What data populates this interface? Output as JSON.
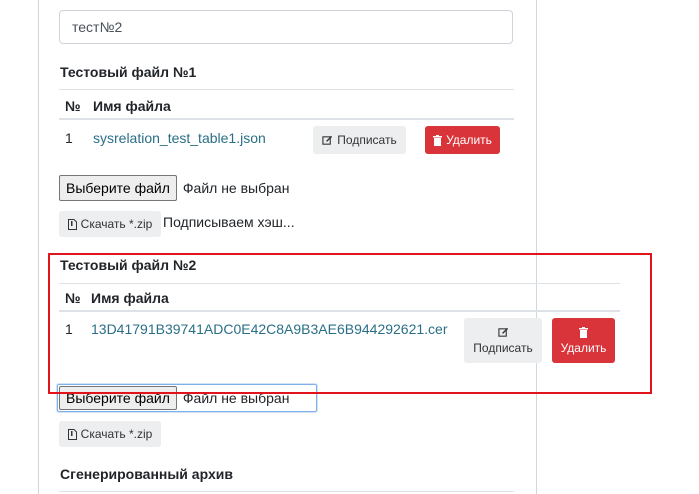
{
  "name_input": {
    "value": "тест№2"
  },
  "file1": {
    "title": "Тестовый файл №1",
    "col_num": "№",
    "col_name": "Имя файла",
    "row": {
      "num": "1",
      "filename": "sysrelation_test_table1.json",
      "sign_label": "Подписать",
      "delete_label": "Удалить"
    },
    "choose_label": "Выберите файл",
    "no_file_label": "Файл не выбран",
    "download_label": "Скачать *.zip",
    "status": "Подписываем хэш..."
  },
  "file2": {
    "title": "Тестовый файл №2",
    "col_num": "№",
    "col_name": "Имя файла",
    "row": {
      "num": "1",
      "filename": "13D41791B39741ADC0E42C8A9B3AE6B944292621.cer",
      "sign_label": "Подписать",
      "delete_label": "Удалить"
    },
    "choose_label": "Выберите файл",
    "no_file_label": "Файл не выбран",
    "download_label": "Скачать *.zip"
  },
  "archive": {
    "title": "Сгенерированный архив"
  },
  "colors": {
    "danger": "#d9343a",
    "highlight": "#e3131b",
    "link": "#2a6f86"
  },
  "icons": {
    "sign": "edit-icon",
    "delete": "trash-icon",
    "download": "file-zip-icon"
  }
}
